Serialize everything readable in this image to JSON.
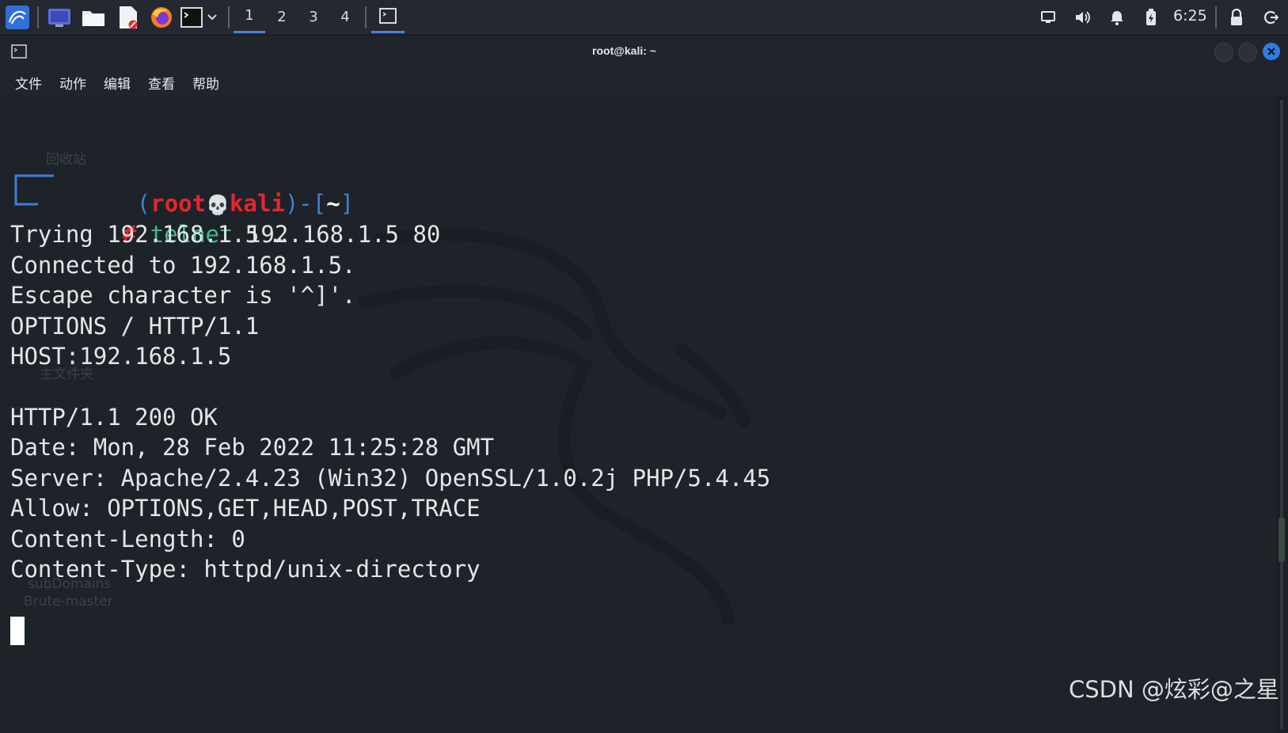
{
  "taskbar": {
    "workspaces": [
      "1",
      "2",
      "3",
      "4"
    ],
    "active_workspace": "1",
    "clock": "6:25",
    "icons": [
      "kali-menu-icon",
      "desktop-icon",
      "file-manager-icon",
      "text-editor-icon",
      "firefox-icon",
      "terminal-icon",
      "dropdown-icon",
      "terminal-window-icon",
      "display-icon",
      "volume-icon",
      "notification-icon",
      "battery-icon",
      "lock-icon",
      "logout-icon"
    ]
  },
  "window": {
    "title": "root@kali: ~",
    "menu": [
      "文件",
      "动作",
      "编辑",
      "查看",
      "帮助"
    ]
  },
  "terminal": {
    "prompt_user": "root",
    "prompt_skull": "💀",
    "prompt_host": "kali",
    "prompt_dir": "~",
    "prompt_hash": "#",
    "command": "telnet",
    "command_args": " 192.168.1.5 80",
    "output": [
      "Trying 192.168.1.5 …",
      "Connected to 192.168.1.5.",
      "Escape character is '^]'.",
      "OPTIONS / HTTP/1.1",
      "HOST:192.168.1.5",
      "",
      "HTTP/1.1 200 OK",
      "Date: Mon, 28 Feb 2022 11:25:28 GMT",
      "Server: Apache/2.4.23 (Win32) OpenSSL/1.0.2j PHP/5.4.45",
      "Allow: OPTIONS,GET,HEAD,POST,TRACE",
      "Content-Length: 0",
      "Content-Type: httpd/unix-directory"
    ]
  },
  "desktop_ghost": {
    "trash_label": "回收站",
    "home_label": "主文件夹",
    "folder_label_1": "subDomains",
    "folder_label_2": "Brute-master"
  },
  "watermark": "CSDN @炫彩@之星",
  "colors": {
    "prompt_red": "#e5252d",
    "prompt_blue": "#3f7ed6",
    "command_green": "#3dbb8c",
    "terminal_bg": "#1e2229",
    "accent": "#4f7fe0"
  }
}
